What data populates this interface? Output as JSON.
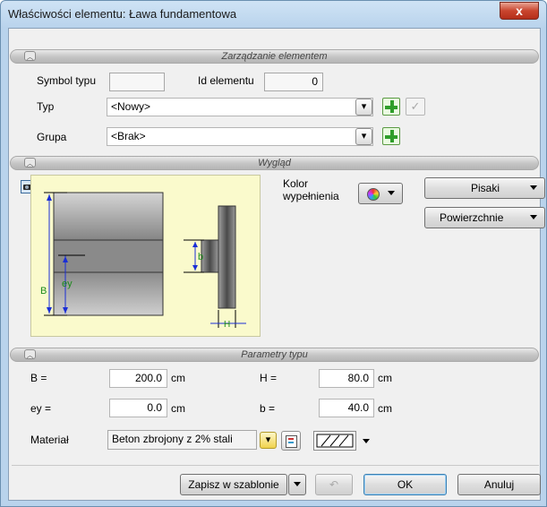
{
  "window": {
    "title": "Właściwości elementu: Ława fundamentowa",
    "close_glyph": "x"
  },
  "sections": {
    "management": "Zarządzanie elementem",
    "appearance": "Wygląd",
    "type_params": "Parametry typu"
  },
  "management": {
    "symbol_label": "Symbol typu",
    "symbol_value": "",
    "id_label": "Id elementu",
    "id_value": "0",
    "type_label": "Typ",
    "type_value": "<Nowy>",
    "group_label": "Grupa",
    "group_value": "<Brak>"
  },
  "appearance": {
    "fill_color_label_1": "Kolor",
    "fill_color_label_2": "wypełnienia",
    "pens_button": "Pisaki",
    "surfaces_button": "Powierzchnie",
    "dims": {
      "B": "B",
      "ey": "ey",
      "b": "b",
      "H": "H"
    }
  },
  "params": {
    "B_label": "B =",
    "B_value": "200.0",
    "B_unit": "cm",
    "H_label": "H =",
    "H_value": "80.0",
    "H_unit": "cm",
    "ey_label": "ey =",
    "ey_value": "0.0",
    "ey_unit": "cm",
    "b_label": "b =",
    "b_value": "40.0",
    "b_unit": "cm",
    "material_label": "Materiał",
    "material_value": "Beton zbrojony z 2% stali"
  },
  "footer": {
    "save_template": "Zapisz w szablonie",
    "ok": "OK",
    "cancel": "Anuluj"
  }
}
